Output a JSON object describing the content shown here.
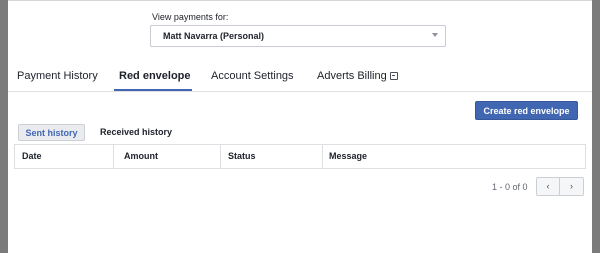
{
  "payments": {
    "view_for_label": "View payments for:",
    "selected_account": "Matt Navarra (Personal)"
  },
  "tabs": [
    {
      "label": "Payment History",
      "active": false
    },
    {
      "label": "Red envelope",
      "active": true
    },
    {
      "label": "Account Settings",
      "active": false
    },
    {
      "label": "Adverts Billing",
      "active": false,
      "icon": "external-link-icon"
    }
  ],
  "actions": {
    "create_label": "Create red envelope"
  },
  "subtabs": [
    {
      "label": "Sent history",
      "active": true
    },
    {
      "label": "Received history",
      "active": false
    }
  ],
  "table": {
    "columns": [
      "Date",
      "Amount",
      "Status",
      "Message"
    ],
    "rows": []
  },
  "pagination": {
    "info": "1 - 0 of 0",
    "prev_icon": "chevron-left-icon",
    "prev_glyph": "‹",
    "next_icon": "chevron-right-icon",
    "next_glyph": "›"
  },
  "colors": {
    "accent": "#4267b2",
    "overlay": "#7f7f7f",
    "border": "#dddfe2"
  }
}
